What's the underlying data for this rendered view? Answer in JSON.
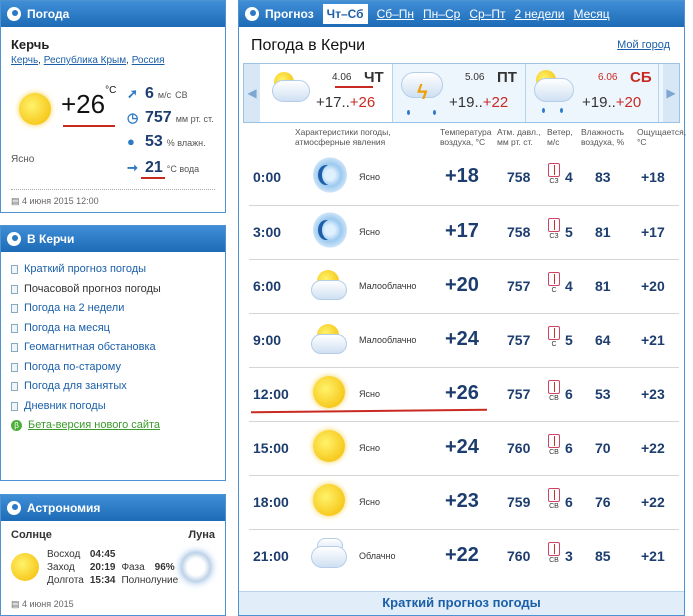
{
  "weather_panel": {
    "title": "Погода",
    "city": "Керчь",
    "region": [
      "Керчь",
      "Республика Крым",
      "Россия"
    ],
    "temp": "+26",
    "temp_unit": "°C",
    "condition": "Ясно",
    "wind_value": "6",
    "wind_unit": "м/с",
    "wind_dir": "СВ",
    "pressure_value": "757",
    "pressure_unit": "мм рт. ст.",
    "humidity_value": "53",
    "humidity_unit": "% влажн.",
    "water_value": "21",
    "water_unit": "°С вода",
    "date": "4 июня 2015 12:00"
  },
  "kerch_panel": {
    "title": "В Керчи",
    "items": [
      "Краткий прогноз погоды",
      "Почасовой прогноз погоды",
      "Погода на 2 недели",
      "Погода на месяц",
      "Геомагнитная обстановка",
      "Погода по-старому",
      "Погода для занятых",
      "Дневник погоды",
      "Бета-версия нового сайта"
    ]
  },
  "astro_panel": {
    "title": "Астрономия",
    "sun_label": "Солнце",
    "moon_label": "Луна",
    "sunrise_label": "Восход",
    "sunrise": "04:45",
    "sunset_label": "Заход",
    "sunset": "20:19",
    "daylength_label": "Долгота",
    "daylength": "15:34",
    "phase_label": "Фаза",
    "phase": "96%",
    "phase_name": "Полнолуние",
    "date": "4 июня 2015"
  },
  "forecast": {
    "header_title": "Прогноз",
    "tabs": [
      "Чт–Сб",
      "Сб–Пн",
      "Пн–Ср",
      "Ср–Пт",
      "2 недели",
      "Месяц"
    ],
    "title": "Погода в Керчи",
    "my_city": "Мой город",
    "days": [
      {
        "num": "4.06",
        "name": "ЧТ",
        "low": "+17..",
        "high": "+26"
      },
      {
        "num": "5.06",
        "name": "ПТ",
        "low": "+19..",
        "high": "+22"
      },
      {
        "num": "6.06",
        "name": "СБ",
        "low": "+19..",
        "high": "+20"
      }
    ],
    "columns": {
      "cond": "Характеристики погоды, атмосферные явления",
      "temp": "Температура воздуха, °С",
      "pres": "Атм. давл., мм рт. ст.",
      "wind": "Ветер, м/с",
      "hum": "Влажность воздуха, %",
      "feel": "Ощущается, °С"
    },
    "rows": [
      {
        "time": "0:00",
        "icon": "moon-clear-icon",
        "cond": "Ясно",
        "temp": "+18",
        "pres": "758",
        "wdir": "СЗ",
        "wspd": "4",
        "hum": "83",
        "feel": "+18"
      },
      {
        "time": "3:00",
        "icon": "moon-clear-icon",
        "cond": "Ясно",
        "temp": "+17",
        "pres": "758",
        "wdir": "СЗ",
        "wspd": "5",
        "hum": "81",
        "feel": "+17"
      },
      {
        "time": "6:00",
        "icon": "partly-cloudy-icon",
        "cond": "Малооблачно",
        "temp": "+20",
        "pres": "757",
        "wdir": "С",
        "wspd": "4",
        "hum": "81",
        "feel": "+20"
      },
      {
        "time": "9:00",
        "icon": "partly-cloudy-icon",
        "cond": "Малооблачно",
        "temp": "+24",
        "pres": "757",
        "wdir": "С",
        "wspd": "5",
        "hum": "64",
        "feel": "+21"
      },
      {
        "time": "12:00",
        "icon": "sun-icon",
        "cond": "Ясно",
        "temp": "+26",
        "pres": "757",
        "wdir": "СВ",
        "wspd": "6",
        "hum": "53",
        "feel": "+23"
      },
      {
        "time": "15:00",
        "icon": "sun-icon",
        "cond": "Ясно",
        "temp": "+24",
        "pres": "760",
        "wdir": "СВ",
        "wspd": "6",
        "hum": "70",
        "feel": "+22"
      },
      {
        "time": "18:00",
        "icon": "sun-icon",
        "cond": "Ясно",
        "temp": "+23",
        "pres": "759",
        "wdir": "СВ",
        "wspd": "6",
        "hum": "76",
        "feel": "+22"
      },
      {
        "time": "21:00",
        "icon": "cloudy-icon",
        "cond": "Облачно",
        "temp": "+22",
        "pres": "760",
        "wdir": "СВ",
        "wspd": "3",
        "hum": "85",
        "feel": "+21"
      }
    ],
    "footer": "Краткий прогноз погоды"
  },
  "colors": {
    "accent": "#1d6bb6",
    "underline_red": "#c82a22",
    "beta_green": "#3b9a2b"
  }
}
